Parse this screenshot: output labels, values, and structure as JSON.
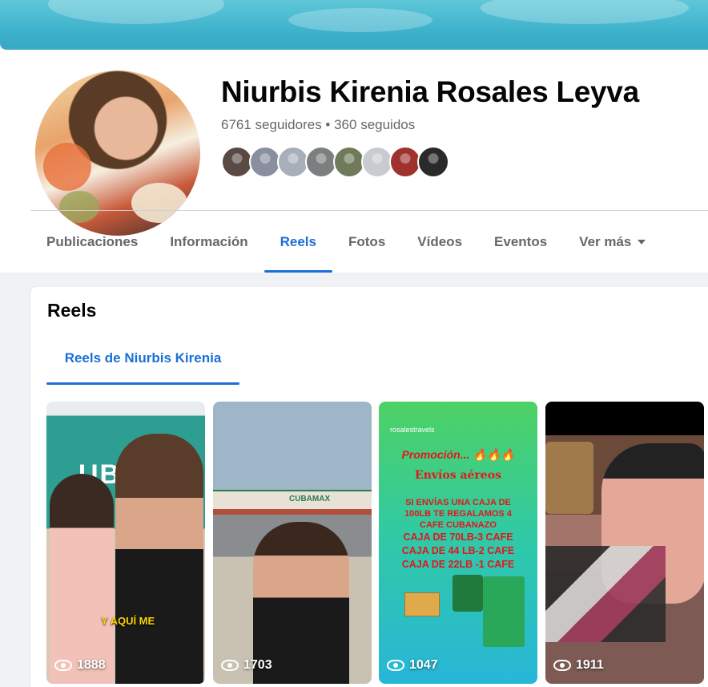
{
  "profile": {
    "name": "Niurbis Kirenia Rosales Leyva",
    "stats": "6761 seguidores • 360 seguidos",
    "friend_avatar_colors": [
      "#5a4a44",
      "#8a8fa0",
      "#a7b0b8",
      "#7c7f80",
      "#6f7a5a",
      "#c8cbcf",
      "#a0322e",
      "#2a2a2a"
    ]
  },
  "tabs": [
    {
      "label": "Publicaciones"
    },
    {
      "label": "Información"
    },
    {
      "label": "Reels",
      "active": true
    },
    {
      "label": "Fotos"
    },
    {
      "label": "Vídeos"
    },
    {
      "label": "Eventos"
    },
    {
      "label": "Ver más"
    }
  ],
  "reels_section": {
    "title": "Reels",
    "subtab": "Reels de Niurbis Kirenia",
    "items": [
      {
        "views": "1888",
        "caption": "Y AQUÍ ME",
        "logo": "UBA"
      },
      {
        "views": "1703",
        "store_sign": "CUBAMAX"
      },
      {
        "views": "1047",
        "handle": "rosalestravels",
        "promo": "Promoción... 🔥🔥🔥",
        "subtitle": "Envíos aéreos",
        "lines": [
          "SI ENVÍAS UNA CAJA DE",
          "100LB TE REGALAMOS 4",
          "CAFE CUBANAZO"
        ],
        "offers": [
          "CAJA DE 70LB-3 CAFE",
          "CAJA DE 44 LB-2 CAFE",
          "CAJA DE 22LB -1 CAFE"
        ]
      },
      {
        "views": "1911"
      }
    ]
  },
  "colors": {
    "accent": "#1b6fd6",
    "muted_text": "#65676b",
    "page_bg": "#f0f2f5"
  }
}
